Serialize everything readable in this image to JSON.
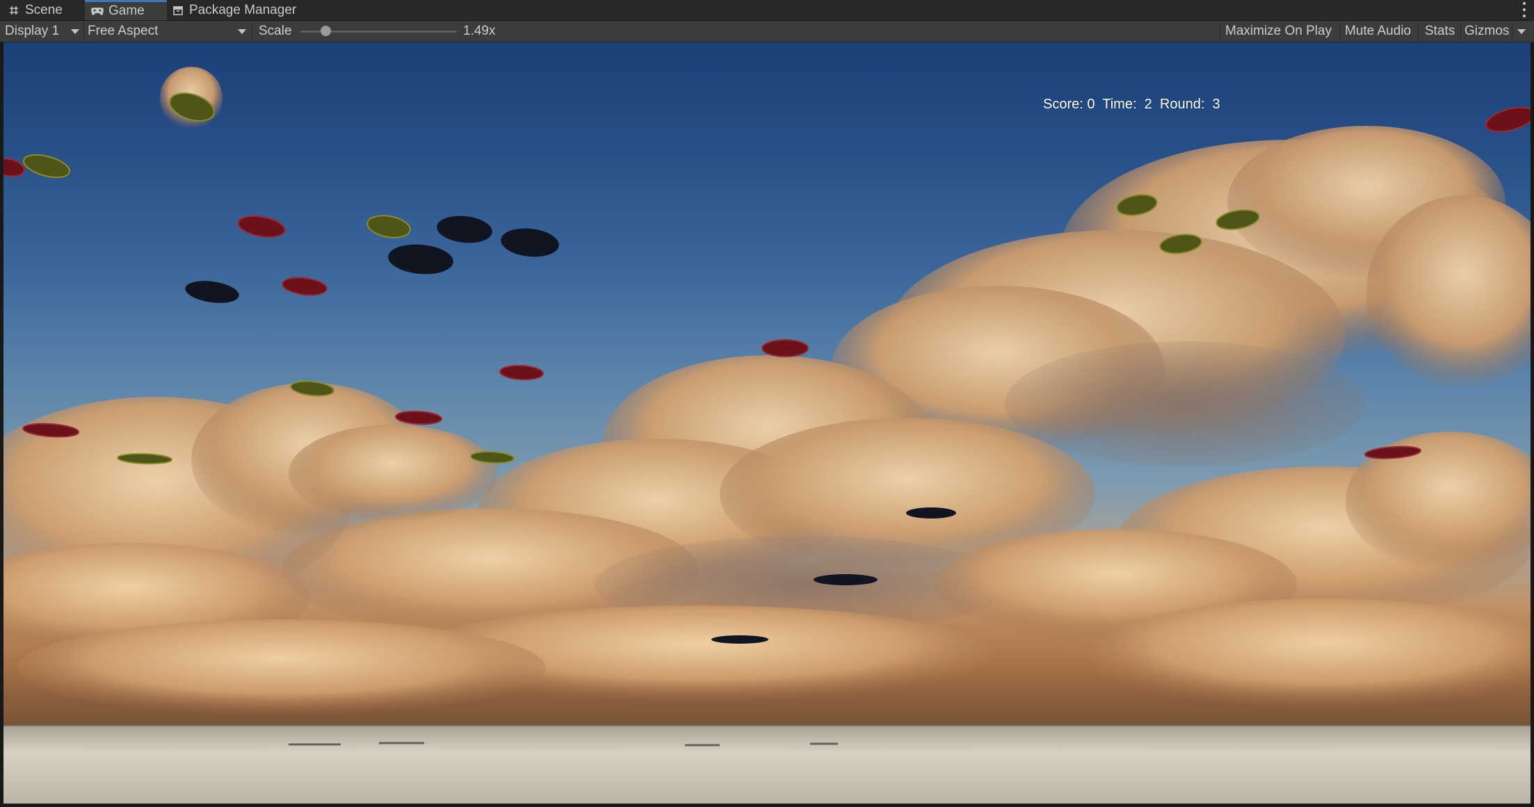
{
  "tabs": [
    {
      "label": "Scene",
      "icon": "hash-grid-icon",
      "active": false
    },
    {
      "label": "Game",
      "icon": "gamepad-icon",
      "active": true
    },
    {
      "label": "Package Manager",
      "icon": "package-icon",
      "active": false
    }
  ],
  "toolbar": {
    "display": "Display 1",
    "aspect": "Free Aspect",
    "scale_label": "Scale",
    "scale_value": "1.49x",
    "scale_slider_fraction": 0.16,
    "maximize": "Maximize On Play",
    "mute": "Mute Audio",
    "stats": "Stats",
    "gizmos": "Gizmos"
  },
  "hud": {
    "score_label": "Score:",
    "score": "0",
    "time_label": "Time:",
    "time": "2",
    "round_label": "Round:",
    "round": "3"
  },
  "colors": {
    "accent_tab": "#3a79bb",
    "disc_red": "#7a1420",
    "disc_olive": "#56591a",
    "disc_black": "#0f1420"
  }
}
